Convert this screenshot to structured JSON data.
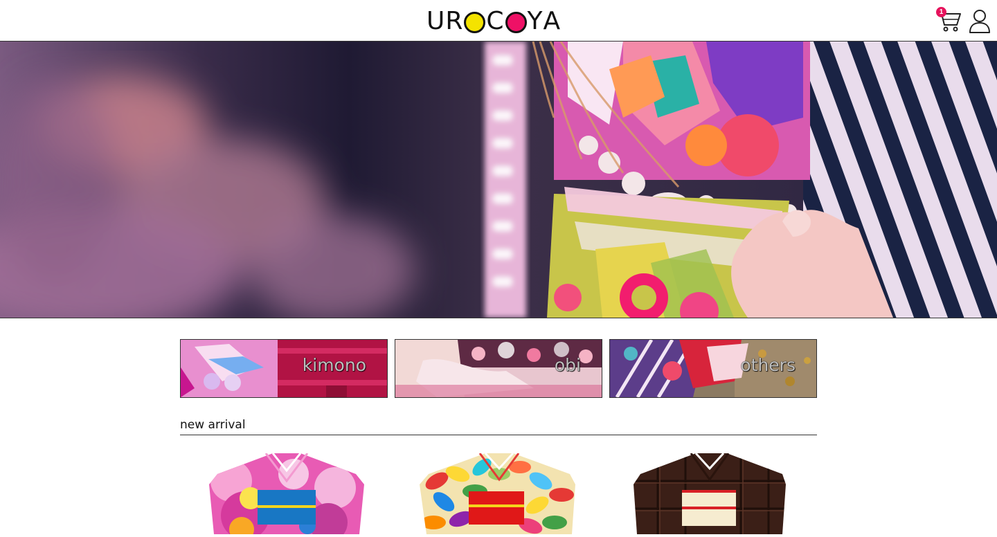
{
  "header": {
    "logo": {
      "letters": [
        "U",
        "R",
        "",
        "C",
        "",
        "Y",
        "A"
      ],
      "text": "UROCOYA",
      "dot_colors": [
        "#f4e300",
        "#ee1166"
      ]
    },
    "cart": {
      "icon": "cart-icon",
      "badge": "1",
      "badge_color": "#e6135c"
    },
    "user": {
      "icon": "user-icon"
    }
  },
  "hero": {
    "alt": "kimono-hero-image"
  },
  "categories": [
    {
      "label": "kimono"
    },
    {
      "label": "obi"
    },
    {
      "label": "others"
    }
  ],
  "new_arrival": {
    "title": "new arrival",
    "products": [
      {
        "pattern": "pink-peony-kimono",
        "obi_color": "#1877c4"
      },
      {
        "pattern": "jellybean-kimono",
        "obi_color": "#e01818"
      },
      {
        "pattern": "chocolate-kimono",
        "obi_color": "#f6ecd0"
      }
    ]
  },
  "colors": {
    "accent": "#ee1166",
    "yellow": "#f4e300",
    "rule": "#333333"
  }
}
